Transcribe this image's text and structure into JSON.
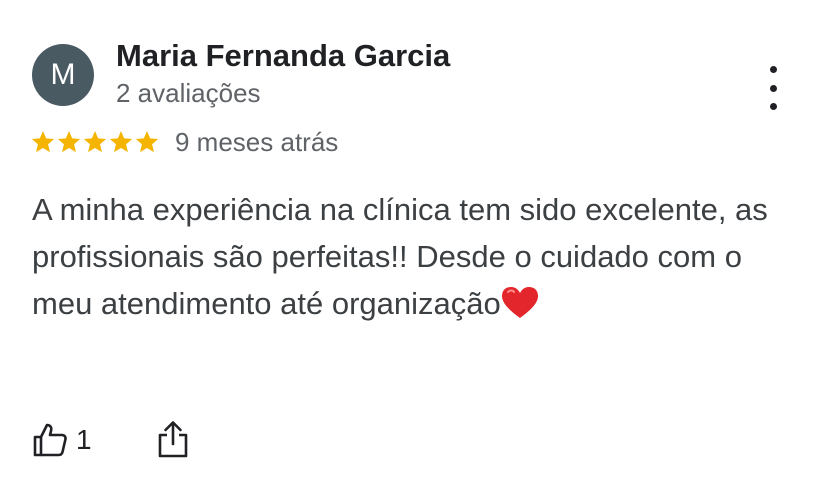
{
  "reviewer": {
    "initial": "M",
    "name": "Maria Fernanda Garcia",
    "reviews_count": "2 avaliações",
    "avatar_color": "#4a5a63"
  },
  "rating": {
    "stars": 5,
    "max_stars": 5,
    "star_color": "#f5b400",
    "date": "9 meses atrás"
  },
  "review": {
    "text": "A minha experiência na clínica tem sido excelente, as profissionais são perfeitas!! Desde o cuidado com o meu atendimento até organização",
    "emoji": "heart-emoji"
  },
  "actions": {
    "like_icon": "thumbs-up-icon",
    "like_count": "1",
    "share_icon": "share-icon",
    "more_icon": "more-vertical-icon"
  }
}
